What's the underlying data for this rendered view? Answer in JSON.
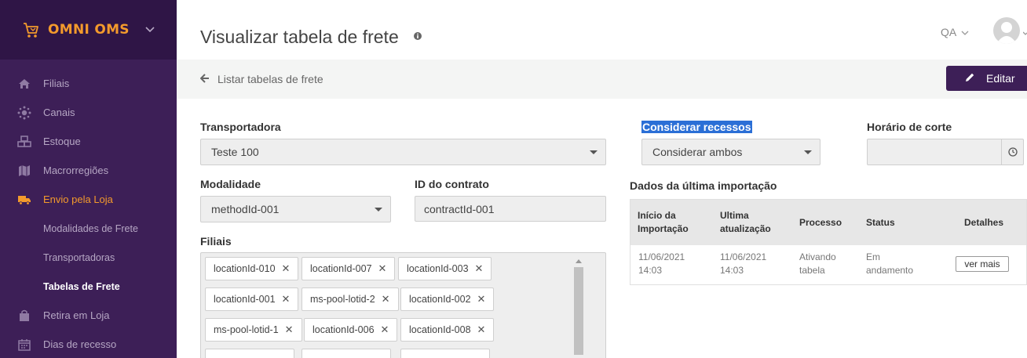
{
  "app": {
    "name": "OMNI OMS",
    "accent": "#f39a2c",
    "sidebar_bg": "#3d1f57"
  },
  "sidebar": {
    "items": [
      {
        "label": "Filiais",
        "icon": "home-icon"
      },
      {
        "label": "Canais",
        "icon": "network-icon"
      },
      {
        "label": "Estoque",
        "icon": "cubes-icon"
      },
      {
        "label": "Macrorregiões",
        "icon": "map-icon"
      },
      {
        "label": "Envio pela Loja",
        "icon": "truck-icon"
      },
      {
        "label": "Retira em Loja",
        "icon": "shopping-bag-icon"
      },
      {
        "label": "Dias de recesso",
        "icon": "calendar-icon"
      }
    ],
    "sub_items": [
      {
        "label": "Modalidades de Frete"
      },
      {
        "label": "Transportadoras"
      },
      {
        "label": "Tabelas de Frete"
      }
    ]
  },
  "header": {
    "title": "Visualizar tabela de frete",
    "environment": "QA"
  },
  "subbar": {
    "back_label": "Listar tabelas de frete",
    "edit_label": "Editar"
  },
  "form": {
    "transportadora": {
      "label": "Transportadora",
      "value": "Teste 100"
    },
    "considerar_recessos": {
      "label": "Considerar recessos",
      "value": "Considerar ambos"
    },
    "horario_corte": {
      "label": "Horário de corte",
      "value": ""
    },
    "modalidade": {
      "label": "Modalidade",
      "value": "methodId-001"
    },
    "id_contrato": {
      "label": "ID do contrato",
      "value": "contractId-001"
    },
    "filiais": {
      "label": "Filiais",
      "tags": [
        "locationId-010",
        "locationId-007",
        "locationId-003",
        "locationId-001",
        "ms-pool-lotid-2",
        "locationId-002",
        "ms-pool-lotid-1",
        "locationId-006",
        "locationId-008"
      ]
    }
  },
  "import": {
    "title": "Dados da última importação",
    "headers": {
      "inicio_l1": "Início da",
      "inicio_l2": "Importação",
      "ultima_l1": "Ultima",
      "ultima_l2": "atualização",
      "processo": "Processo",
      "status": "Status",
      "detalhes": "Detalhes"
    },
    "row": {
      "inicio_date": "11/06/2021",
      "inicio_time": "14:03",
      "ultima_date": "11/06/2021",
      "ultima_time": "14:03",
      "processo_l1": "Ativando",
      "processo_l2": "tabela",
      "status_l1": "Em",
      "status_l2": "andamento",
      "button": "ver mais"
    }
  }
}
